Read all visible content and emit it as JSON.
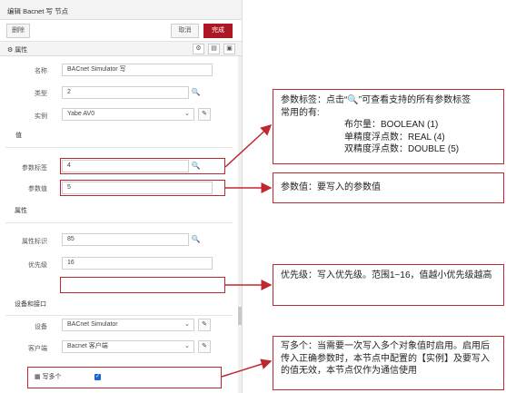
{
  "window": {
    "title": "编辑 Bacnet 写 节点"
  },
  "toolbar": {
    "delete_label": "删除",
    "cancel_label": "取消",
    "done_label": "完成"
  },
  "tab": {
    "label": "属性",
    "gear_icon": "gear-icon",
    "doc_icon": "document-icon",
    "layout_icon": "frame-icon"
  },
  "fields": {
    "name": {
      "label": "名称",
      "value": "BACnet Simulator 写"
    },
    "type": {
      "label": "类型",
      "value": "2"
    },
    "instance": {
      "label": "实例",
      "value": "Yabe AV0"
    },
    "value_section": "值",
    "param_tag": {
      "label": "参数标签",
      "value": "4"
    },
    "param_value": {
      "label": "参数值",
      "value": "5"
    },
    "property_section": "属性",
    "property_id": {
      "label": "属性标识",
      "value": "85"
    },
    "priority": {
      "label": "优先级",
      "value": "16"
    },
    "device_section": "设备和接口",
    "device": {
      "label": "设备",
      "value": "BACnet Simulator"
    },
    "client": {
      "label": "客户端",
      "value": "Bacnet 客户端"
    },
    "write_multiple": {
      "label": "写多个",
      "checked": true
    }
  },
  "callouts": {
    "param_tag": {
      "line1": "参数标签：点击“🔍”可查看支持的所有参数标签",
      "line2": "常用的有:",
      "line3": "布尔量：BOOLEAN (1)",
      "line4": "单精度浮点数：REAL (4)",
      "line5": "双精度浮点数：DOUBLE (5)"
    },
    "param_value": {
      "text": "参数值：要写入的参数值"
    },
    "priority": {
      "text": "优先级：写入优先级。范围1~16，值越小优先级越高"
    },
    "write_multiple": {
      "text": "写多个：当需要一次写入多个对象值时启用。启用后传入正确参数时，本节点中配置的【实例】及要写入的值无效，本节点仅作为通信使用"
    }
  },
  "colors": {
    "accent": "#ad1625",
    "annotation": "#c0282f",
    "checkbox": "#1a66d6"
  }
}
